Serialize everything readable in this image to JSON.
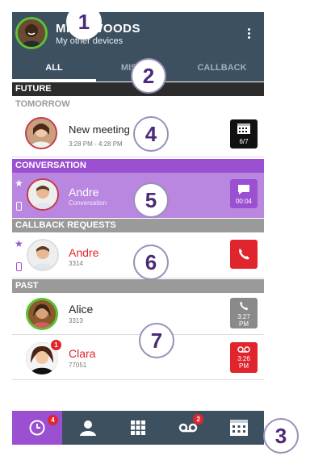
{
  "header": {
    "name": "MIKE WOODS",
    "subtitle": "My other devices"
  },
  "tabs": [
    {
      "label": "ALL",
      "active": true
    },
    {
      "label": "MISSED",
      "active": false
    },
    {
      "label": "CALLBACK",
      "active": false
    }
  ],
  "sections": {
    "future": "FUTURE",
    "tomorrow": "TOMORROW",
    "conversation": "CONVERSATION",
    "callback": "CALLBACK REQUESTS",
    "past": "PAST"
  },
  "meeting": {
    "title": "New meeting",
    "time": "3:28 PM - 4:28 PM",
    "date": "6/7"
  },
  "conversation": {
    "name": "Andre",
    "sub": "Conversation",
    "duration": "00:04"
  },
  "callback_item": {
    "name": "Andre",
    "number": "3314"
  },
  "past": [
    {
      "name": "Alice",
      "number": "3313",
      "time": "3:27",
      "ampm": "PM"
    },
    {
      "name": "Clara",
      "number": "77051",
      "time": "3:26",
      "ampm": "PM",
      "badge": "1"
    }
  ],
  "nav": {
    "history_badge": "4",
    "voicemail_badge": "2"
  },
  "callouts": [
    "1",
    "2",
    "3",
    "4",
    "5",
    "6",
    "7"
  ],
  "colors": {
    "header": "#3d5060",
    "accent": "#9b4fd1",
    "missed": "#e1252d",
    "presence": "#5bc236"
  }
}
